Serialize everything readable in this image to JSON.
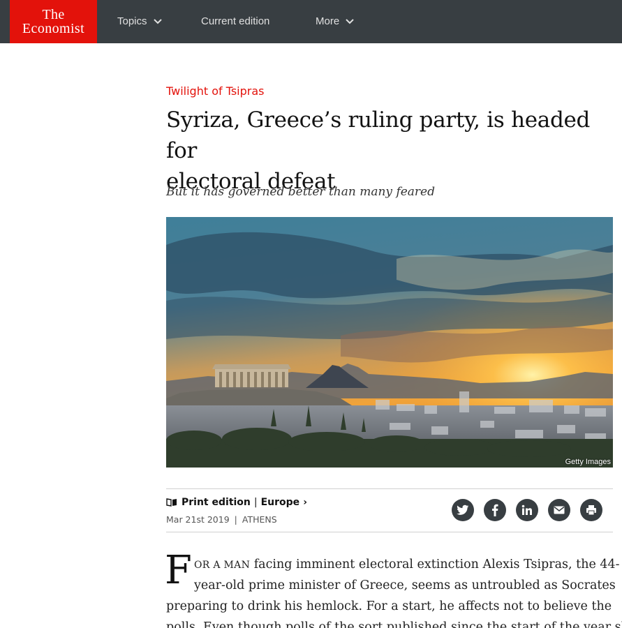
{
  "header": {
    "logo_line1": "The",
    "logo_line2": "Economist",
    "nav": [
      {
        "label": "Topics",
        "has_dropdown": true
      },
      {
        "label": "Current edition",
        "has_dropdown": false
      },
      {
        "label": "More",
        "has_dropdown": true
      }
    ],
    "colors": {
      "bar": "#383e42",
      "brand_red": "#e3120b"
    }
  },
  "article": {
    "flytitle": "Twilight of Tsipras",
    "headline_line1": "Syriza, Greece’s ruling party, is headed for",
    "headline_line2": "electoral defeat",
    "rubric": "But it has governed better than many feared",
    "image_credit": "Getty Images",
    "section_label": "Print edition",
    "section_separator": "|",
    "section_name": "Europe",
    "section_arrow": "›",
    "date": "Mar 21st 2019",
    "dateline_separator": "|",
    "location": "ATHENS",
    "share_buttons": [
      "twitter-icon",
      "facebook-icon",
      "linkedin-icon",
      "email-icon",
      "print-icon"
    ],
    "dropcap": "F",
    "lead_smallcaps": "OR A MAN",
    "body_line1_rest": " facing imminent electoral extinction Alexis Tsipras, the 44-",
    "body_line2": "year-old prime minister of Greece, seems as untroubled as Socrates",
    "body_line3": "preparing to drink his hemlock. For a start, he affects not to believe the",
    "body_line4": "polls. Even though polls of the sort published since the start of the year show"
  }
}
